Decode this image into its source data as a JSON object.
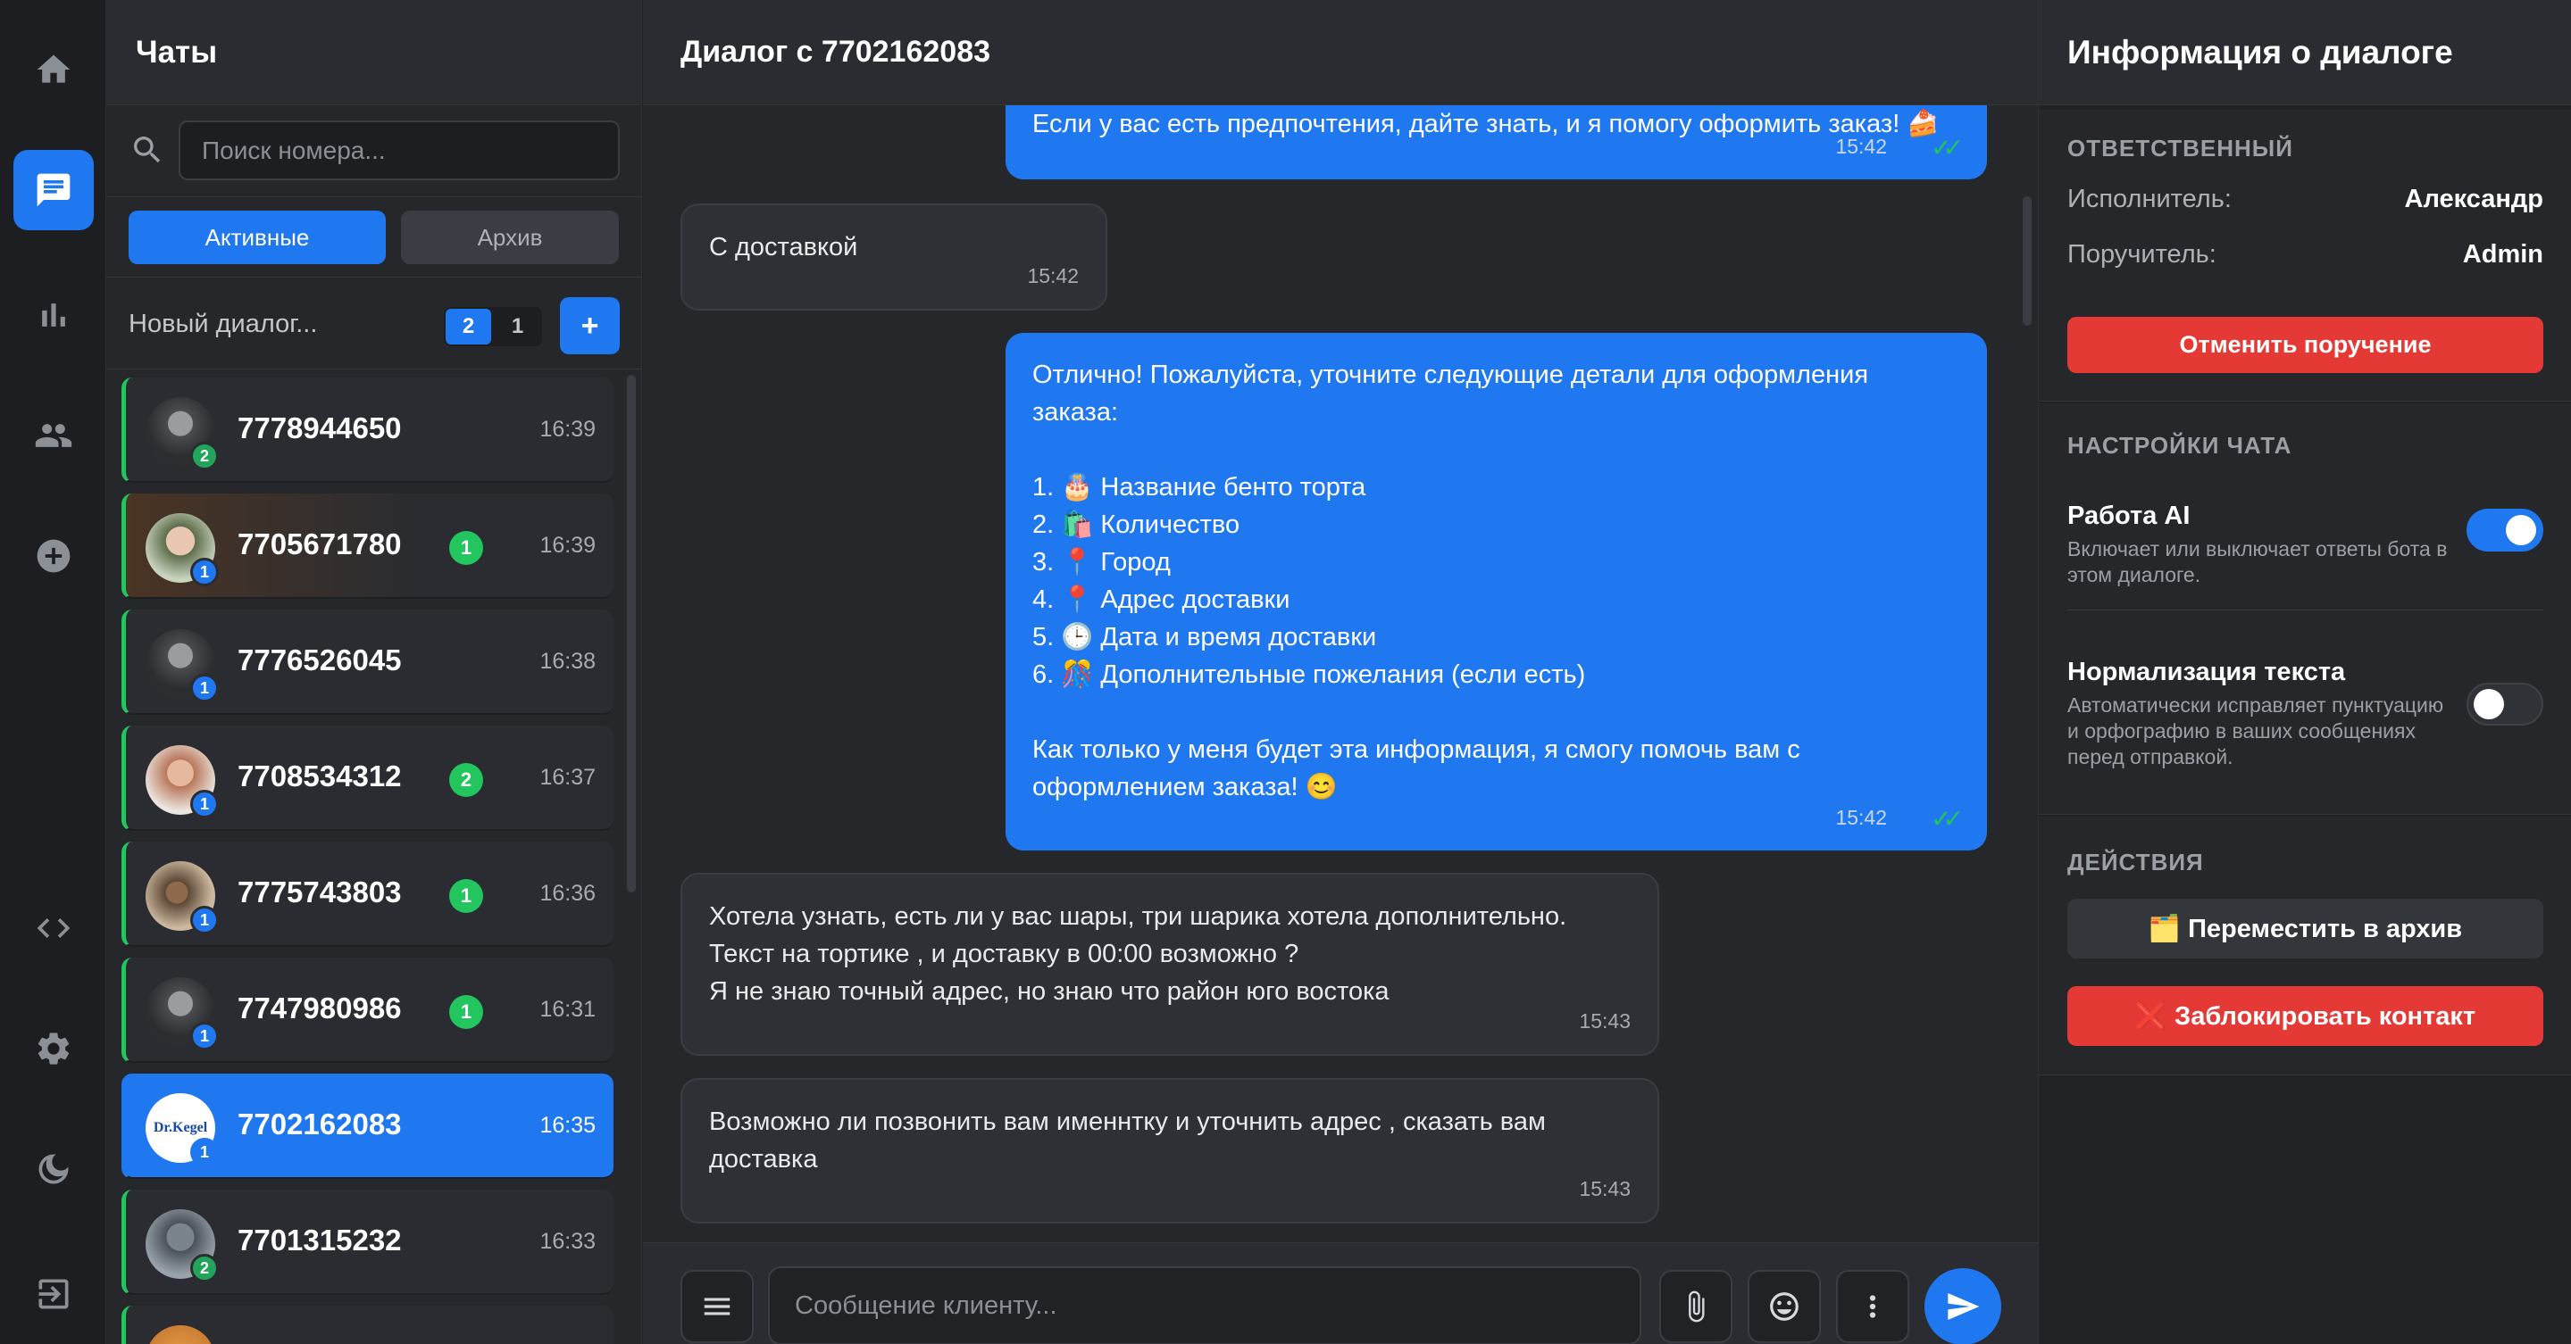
{
  "chats_panel": {
    "title": "Чаты",
    "search_placeholder": "Поиск номера...",
    "tab_active": "Активные",
    "tab_archive": "Архив",
    "new_dialog_label": "Новый диалог...",
    "pager": [
      "2",
      "1"
    ],
    "add_label": "+",
    "items": [
      {
        "phone": "7778944650",
        "time": "16:39",
        "badge": "2",
        "badge_color": "#22a55a",
        "unread": ""
      },
      {
        "phone": "7705671780",
        "time": "16:39",
        "badge": "1",
        "badge_color": "#1f78f0",
        "unread": "1"
      },
      {
        "phone": "7776526045",
        "time": "16:38",
        "badge": "1",
        "badge_color": "#1f78f0",
        "unread": ""
      },
      {
        "phone": "7708534312",
        "time": "16:37",
        "badge": "1",
        "badge_color": "#1f78f0",
        "unread": "2"
      },
      {
        "phone": "7775743803",
        "time": "16:36",
        "badge": "1",
        "badge_color": "#1f78f0",
        "unread": "1"
      },
      {
        "phone": "7747980986",
        "time": "16:31",
        "badge": "1",
        "badge_color": "#1f78f0",
        "unread": "1"
      },
      {
        "phone": "7702162083",
        "time": "16:35",
        "badge": "1",
        "badge_color": "#1f78f0",
        "unread": "",
        "logo_text": "Dr.Kegel"
      },
      {
        "phone": "7701315232",
        "time": "16:33",
        "badge": "2",
        "badge_color": "#22a55a",
        "unread": ""
      }
    ]
  },
  "dialog": {
    "title": "Диалог с 7702162083",
    "messages": [
      {
        "text": "Если у вас есть предпочтения, дайте знать, и я помогу оформить заказ! 🍰",
        "time": "15:42"
      },
      {
        "text": "С доставкой",
        "time": "15:42"
      },
      {
        "text": "Отлично! Пожалуйста, уточните следующие детали для оформления заказа:\n\n1. 🎂 Название бенто торта\n2. 🛍️ Количество\n3. 📍 Город\n4. 📍 Адрес доставки\n5. 🕒 Дата и время доставки\n6. 🎊 Дополнительные пожелания (если есть)\n\nКак только у меня будет эта информация, я смогу помочь вам с оформлением заказа! 😊",
        "time": "15:42"
      },
      {
        "text": "Хотела узнать, есть ли у вас шары, три шарика хотела дополнительно.\nТекст на тортике , и доставку в 00:00 возможно ?\nЯ не знаю точный адрес, но знаю что район юго востока",
        "time": "15:43"
      },
      {
        "text": "Возможно ли позвонить вам именнтку и уточнить адрес , сказать вам доставка",
        "time": "15:43"
      }
    ],
    "composer_placeholder": "Сообщение клиенту..."
  },
  "info": {
    "title": "Информация о диалоге",
    "responsible_title": "ОТВЕТСТВЕННЫЙ",
    "executor_label": "Исполнитель:",
    "executor_value": "Александр",
    "assigner_label": "Поручитель:",
    "assigner_value": "Admin",
    "cancel_button": "Отменить поручение",
    "settings_title": "НАСТРОЙКИ ЧАТА",
    "ai_title": "Работа AI",
    "ai_desc": "Включает или выключает ответы бота в этом диалоге.",
    "ai_on": true,
    "norm_title": "Нормализация текста",
    "norm_desc": "Автоматически исправляет пунктуацию и орфографию в ваших сообщениях перед отправкой.",
    "norm_on": false,
    "actions_title": "ДЕЙСТВИЯ",
    "archive_button": "🗂️ Переместить в архив",
    "block_button": "❌ Заблокировать контакт"
  },
  "colors": {
    "accent": "#1f78f0",
    "online": "#22c55e",
    "danger": "#e53935"
  }
}
